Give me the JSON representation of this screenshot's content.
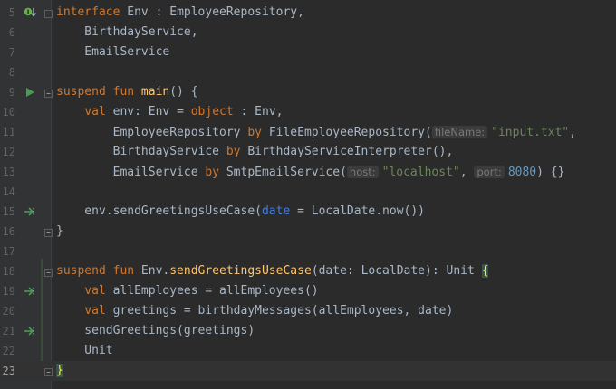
{
  "editor": {
    "lines": [
      {
        "n": "5",
        "gutter": "implemented-icon",
        "fold": true,
        "parts": [
          [
            "kw",
            "interface "
          ],
          [
            "t",
            "Env : EmployeeRepository,"
          ]
        ]
      },
      {
        "n": "6",
        "parts": [
          [
            "t",
            "    BirthdayService,"
          ]
        ]
      },
      {
        "n": "7",
        "parts": [
          [
            "t",
            "    EmailService"
          ]
        ]
      },
      {
        "n": "8",
        "parts": []
      },
      {
        "n": "9",
        "gutter": "run-icon",
        "fold": true,
        "parts": [
          [
            "kw",
            "suspend fun "
          ],
          [
            "fn",
            "main"
          ],
          [
            "t",
            "() {"
          ]
        ]
      },
      {
        "n": "10",
        "parts": [
          [
            "t",
            "    "
          ],
          [
            "kw",
            "val "
          ],
          [
            "t",
            "env: Env = "
          ],
          [
            "kw",
            "object "
          ],
          [
            "t",
            ": Env,"
          ]
        ]
      },
      {
        "n": "11",
        "parts": [
          [
            "t",
            "        EmployeeRepository "
          ],
          [
            "kw",
            "by "
          ],
          [
            "t",
            "FileEmployeeRepository("
          ],
          [
            "hint",
            "fileName:"
          ],
          [
            "str",
            "\"input.txt\""
          ],
          [
            "t",
            ","
          ]
        ]
      },
      {
        "n": "12",
        "parts": [
          [
            "t",
            "        BirthdayService "
          ],
          [
            "kw",
            "by "
          ],
          [
            "t",
            "BirthdayServiceInterpreter(),"
          ]
        ]
      },
      {
        "n": "13",
        "parts": [
          [
            "t",
            "        EmailService "
          ],
          [
            "kw",
            "by "
          ],
          [
            "t",
            "SmtpEmailService("
          ],
          [
            "hint",
            "host:"
          ],
          [
            "str",
            "\"localhost\""
          ],
          [
            "t",
            ", "
          ],
          [
            "hint",
            "port:"
          ],
          [
            "num",
            "8080"
          ],
          [
            "t",
            ") {}"
          ]
        ]
      },
      {
        "n": "14",
        "parts": []
      },
      {
        "n": "15",
        "gutter": "suspend-call-icon",
        "parts": [
          [
            "t",
            "    env.sendGreetingsUseCase("
          ],
          [
            "prm",
            "date"
          ],
          [
            "t",
            " = LocalDate.now())"
          ]
        ]
      },
      {
        "n": "16",
        "fold": true,
        "parts": [
          [
            "t",
            "}"
          ]
        ]
      },
      {
        "n": "17",
        "parts": []
      },
      {
        "n": "18",
        "fold": true,
        "parts": [
          [
            "kw",
            "suspend fun "
          ],
          [
            "t",
            "Env."
          ],
          [
            "fn",
            "sendGreetingsUseCase"
          ],
          [
            "t",
            "(date: LocalDate): Unit "
          ],
          [
            "hl",
            "{"
          ]
        ]
      },
      {
        "n": "19",
        "gutter": "suspend-call-icon",
        "parts": [
          [
            "t",
            "    "
          ],
          [
            "kw",
            "val "
          ],
          [
            "t",
            "allEmployees = allEmployees()"
          ]
        ]
      },
      {
        "n": "20",
        "parts": [
          [
            "t",
            "    "
          ],
          [
            "kw",
            "val "
          ],
          [
            "t",
            "greetings = birthdayMessages(allEmployees, date)"
          ]
        ]
      },
      {
        "n": "21",
        "gutter": "suspend-call-icon",
        "parts": [
          [
            "t",
            "    sendGreetings(greetings)"
          ]
        ]
      },
      {
        "n": "22",
        "parts": [
          [
            "t",
            "    Unit"
          ]
        ]
      },
      {
        "n": "23",
        "current": true,
        "fold": true,
        "parts": [
          [
            "hl",
            "}"
          ]
        ]
      }
    ],
    "colors": {
      "background": "#2b2b2b",
      "keyword": "#cc7832",
      "function": "#ffc66d",
      "string": "#6a8759",
      "number": "#6897bb",
      "text": "#a9b7c6",
      "brace_highlight": "#ffef28"
    }
  }
}
